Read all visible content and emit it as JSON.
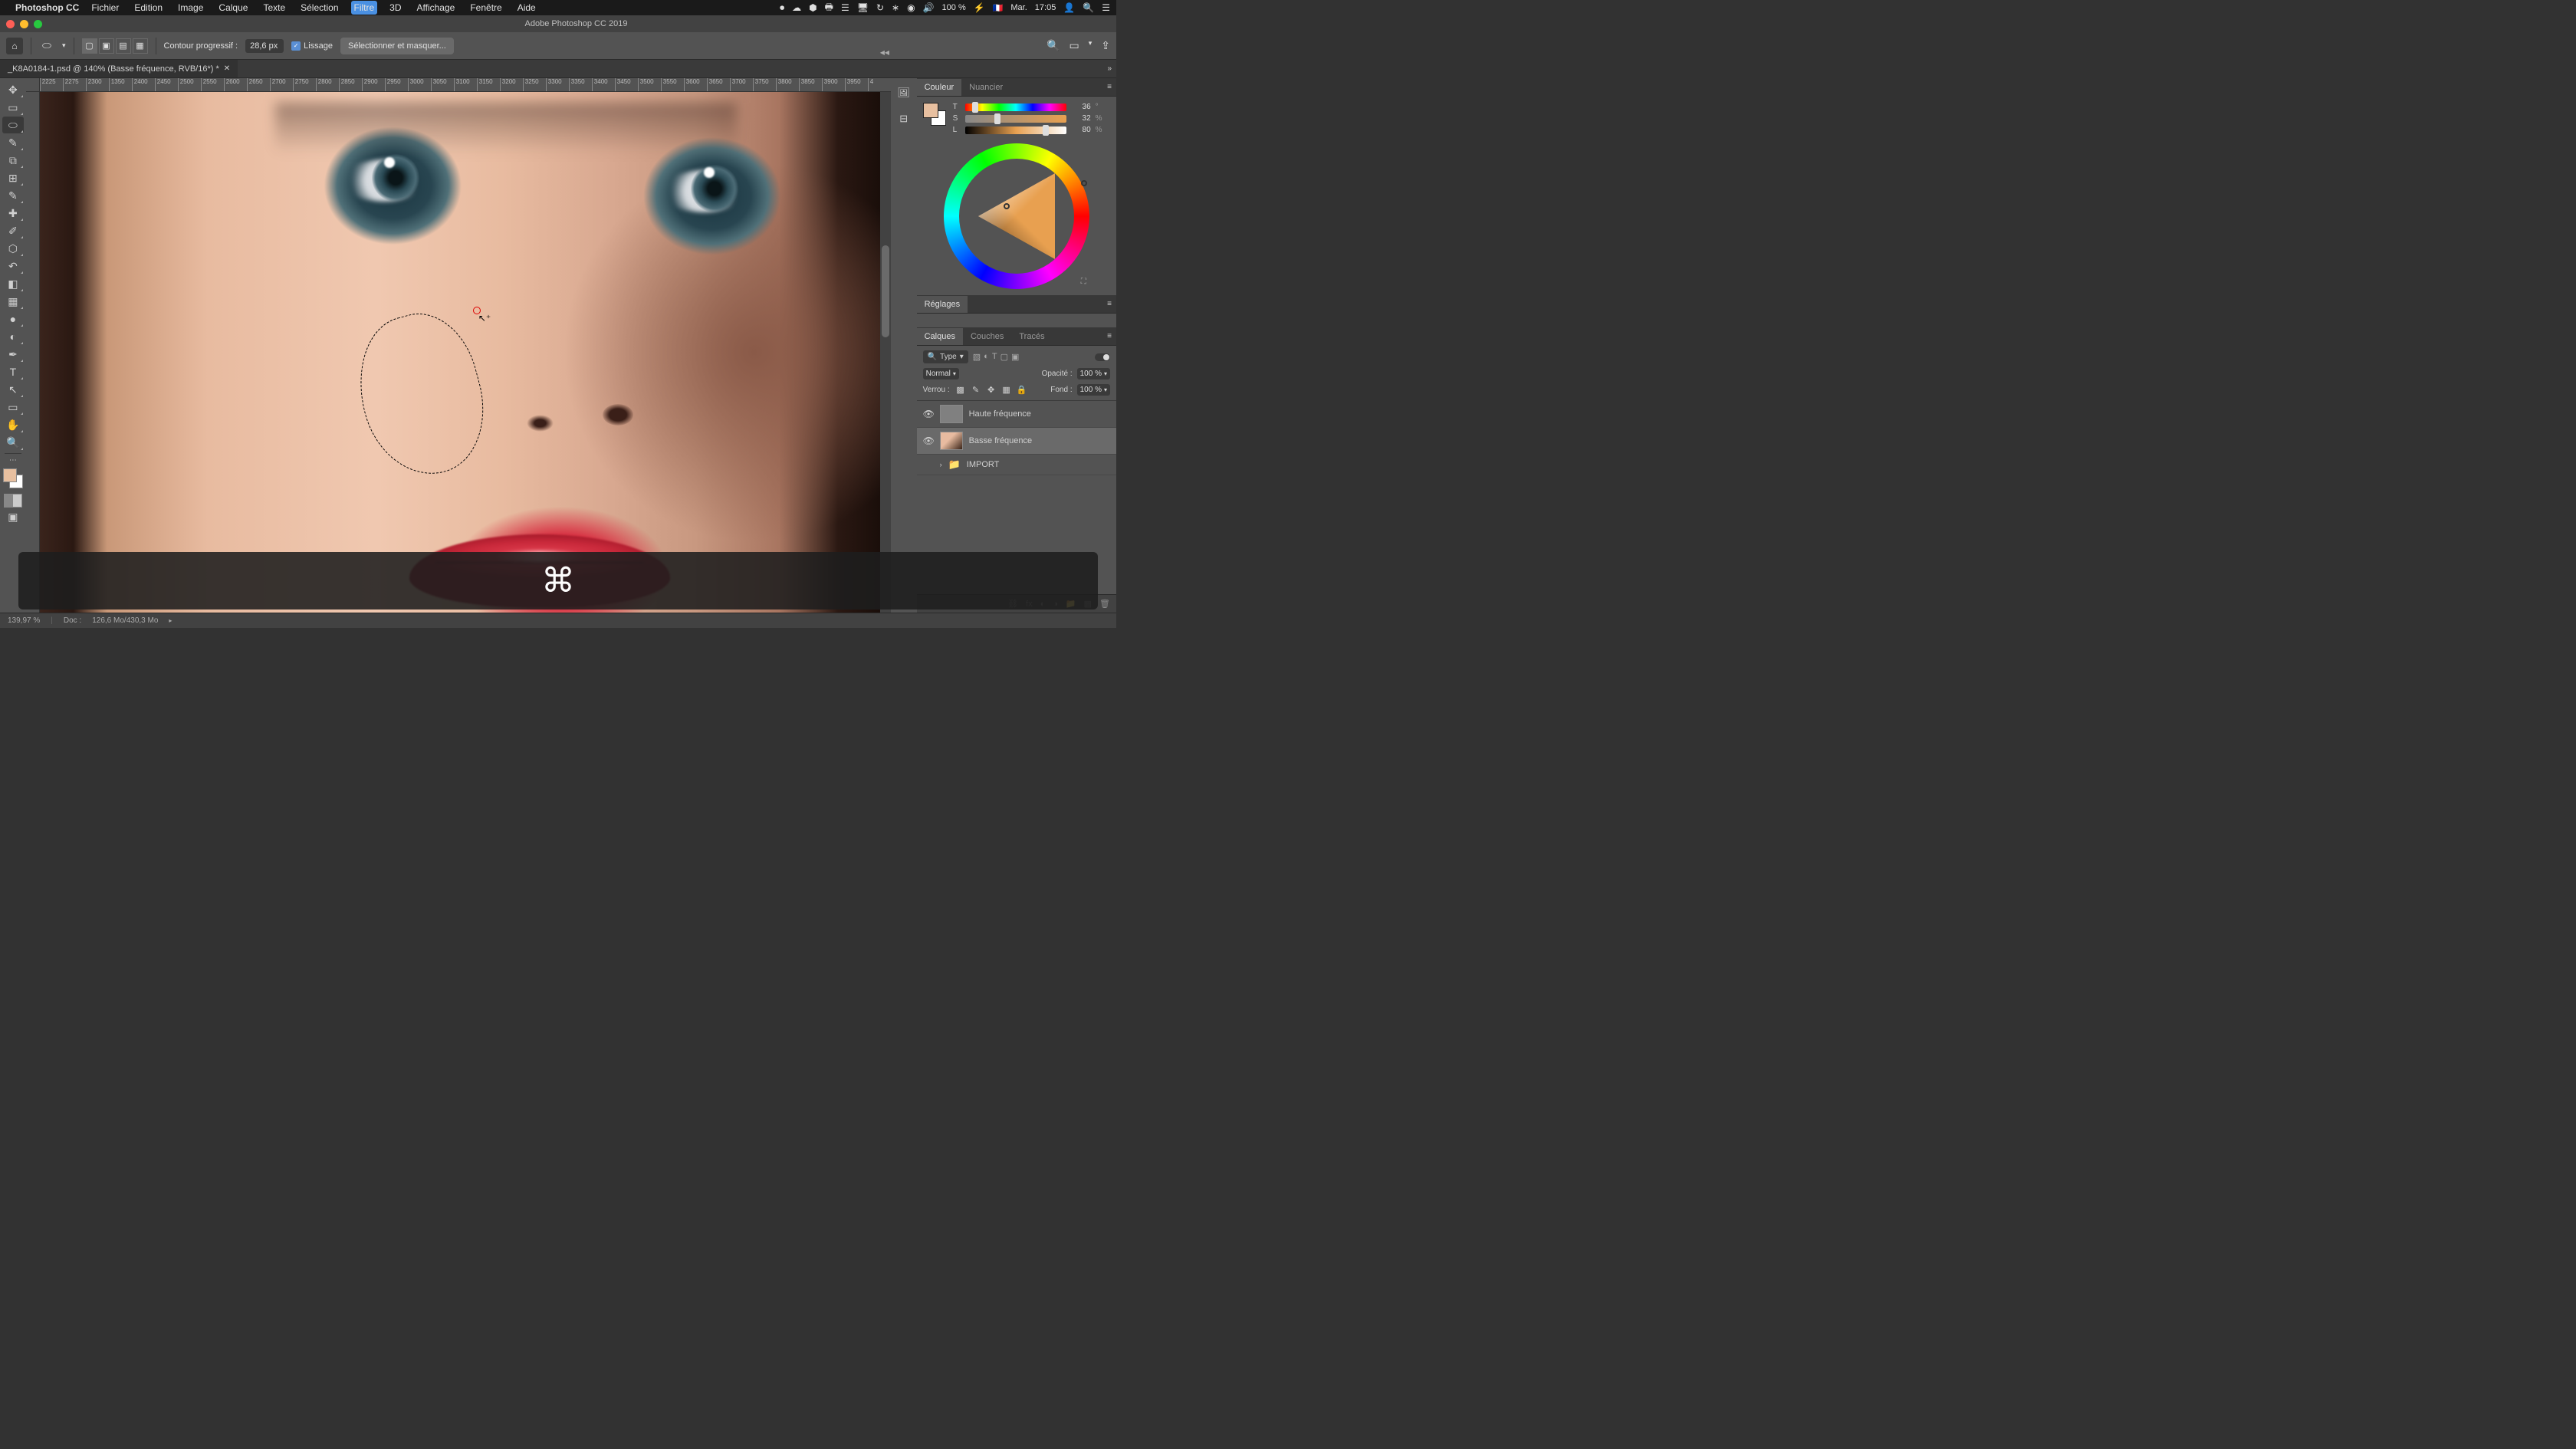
{
  "menubar": {
    "app": "Photoshop CC",
    "items": [
      "Fichier",
      "Edition",
      "Image",
      "Calque",
      "Texte",
      "Sélection",
      "Filtre",
      "3D",
      "Affichage",
      "Fenêtre",
      "Aide"
    ],
    "active_index": 6,
    "battery": "100 %",
    "charging_icon": "⚡",
    "flag": "🇫🇷",
    "day": "Mar.",
    "time": "17:05"
  },
  "window": {
    "title": "Adobe Photoshop CC 2019"
  },
  "options": {
    "feather_label": "Contour progressif :",
    "feather_value": "28,6 px",
    "antialias_label": "Lissage",
    "select_mask": "Sélectionner et masquer..."
  },
  "doc_tab": {
    "name": "_K8A0184-1.psd @ 140% (Basse fréquence, RVB/16*) *"
  },
  "ruler_ticks": [
    "2225",
    "2275",
    "2300",
    "1350",
    "2400",
    "2450",
    "2500",
    "2550",
    "2600",
    "2650",
    "2700",
    "2750",
    "2800",
    "2850",
    "2900",
    "2950",
    "3000",
    "3050",
    "3100",
    "3150",
    "3200",
    "3250",
    "3300",
    "3350",
    "3400",
    "3450",
    "3500",
    "3550",
    "3600",
    "3650",
    "3700",
    "3750",
    "3800",
    "3850",
    "3900",
    "3950",
    "4"
  ],
  "panels": {
    "color_tab": "Couleur",
    "swatches_tab": "Nuancier",
    "hsb": {
      "t_label": "T",
      "s_label": "S",
      "l_label": "L",
      "t": "36",
      "s": "32",
      "l": "80",
      "unit": "°",
      "pct": "%"
    },
    "adjustments_tab": "Réglages",
    "layers_tab": "Calques",
    "channels_tab": "Couches",
    "paths_tab": "Tracés",
    "kind_label": "Type",
    "blend_mode": "Normal",
    "opacity_label": "Opacité :",
    "opacity_val": "100 %",
    "lock_label": "Verrou :",
    "fill_label": "Fond :",
    "fill_val": "100 %",
    "layers": [
      {
        "name": "Haute fréquence",
        "visible": true,
        "thumb": "hf"
      },
      {
        "name": "Basse fréquence",
        "visible": true,
        "thumb": "bf",
        "selected": true
      },
      {
        "name": "IMPORT",
        "visible": false,
        "folder": true
      }
    ]
  },
  "shortcut": {
    "symbol": "⌘"
  },
  "status": {
    "zoom": "139,97 %",
    "doc_label": "Doc :",
    "doc": "126,6 Mo/430,3 Mo"
  }
}
